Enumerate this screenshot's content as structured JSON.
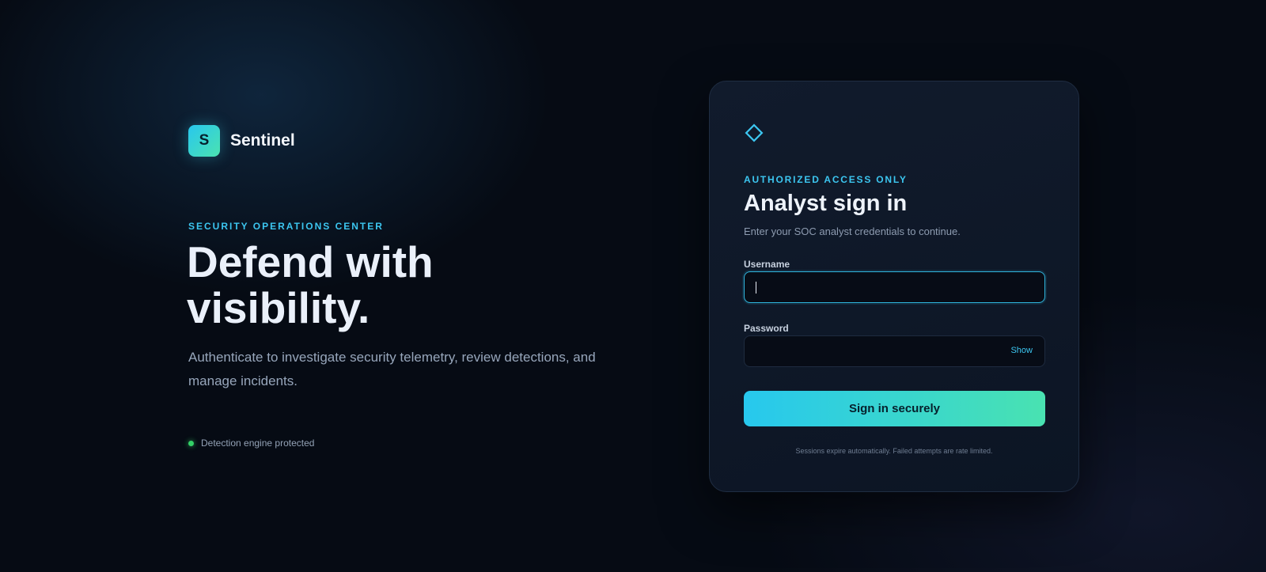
{
  "brand": {
    "logo_letter": "S",
    "name": "Sentinel"
  },
  "hero": {
    "eyebrow": "SECURITY OPERATIONS CENTER",
    "title": "Defend with visibility.",
    "description": "Authenticate to investigate security telemetry, review detections, and manage incidents.",
    "status_text": "Detection engine protected",
    "status_color": "#33d067"
  },
  "card": {
    "icon": "diamond-icon",
    "eyebrow": "AUTHORIZED ACCESS ONLY",
    "title": "Analyst sign in",
    "subtitle": "Enter your SOC analyst credentials to continue.",
    "username": {
      "label": "Username",
      "value": "",
      "placeholder": ""
    },
    "password": {
      "label": "Password",
      "value": "",
      "placeholder": "",
      "toggle_label": "Show"
    },
    "submit_label": "Sign in securely",
    "note": "Sessions expire automatically. Failed attempts are rate limited."
  },
  "colors": {
    "accent": "#3cc6f0",
    "gradient_start": "#27c8ee",
    "gradient_end": "#49e2b1",
    "background": "#060b14",
    "card_background": "#0f1828"
  }
}
